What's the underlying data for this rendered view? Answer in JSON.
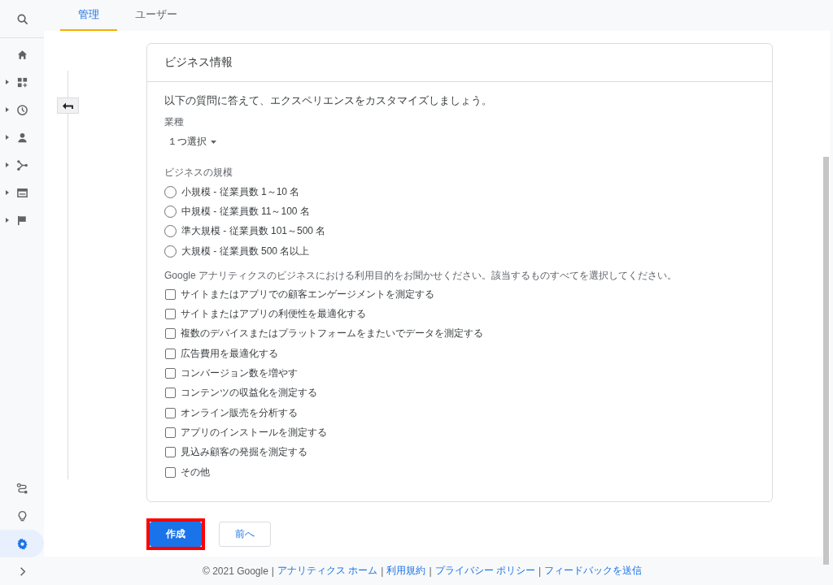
{
  "sidebar": {
    "top_items": [
      {
        "kind": "search",
        "expandable": false,
        "selected": false
      },
      {
        "kind": "home",
        "expandable": false,
        "selected": false
      },
      {
        "kind": "dashboard",
        "expandable": true,
        "selected": false
      },
      {
        "kind": "clock",
        "expandable": true,
        "selected": false
      },
      {
        "kind": "person",
        "expandable": true,
        "selected": false
      },
      {
        "kind": "branch",
        "expandable": true,
        "selected": false
      },
      {
        "kind": "screen",
        "expandable": true,
        "selected": false
      },
      {
        "kind": "flag",
        "expandable": true,
        "selected": false
      }
    ],
    "bottom_items": [
      {
        "kind": "route",
        "expandable": false,
        "selected": false
      },
      {
        "kind": "bulb",
        "expandable": false,
        "selected": false
      },
      {
        "kind": "gear",
        "expandable": false,
        "selected": true
      },
      {
        "kind": "chevron",
        "expandable": false,
        "selected": false
      }
    ]
  },
  "tabs": [
    {
      "label": "管理",
      "selected": true
    },
    {
      "label": "ユーザー",
      "selected": false
    }
  ],
  "card": {
    "title": "ビジネス情報",
    "intro": "以下の質問に答えて、エクスペリエンスをカスタマイズしましょう。",
    "industry": {
      "label": "業種",
      "value": "１つ選択"
    },
    "size": {
      "label": "ビジネスの規模",
      "options": [
        {
          "label": "小規模 - 従業員数 1～10 名",
          "selected": false
        },
        {
          "label": "中規模 - 従業員数 11～100 名",
          "selected": false
        },
        {
          "label": "準大規模 - 従業員数 101～500 名",
          "selected": false
        },
        {
          "label": "大規模 - 従業員数 500 名以上",
          "selected": false
        }
      ]
    },
    "purpose": {
      "label": "Google アナリティクスのビジネスにおける利用目的をお聞かせください。該当するものすべてを選択してください。",
      "options": [
        {
          "label": "サイトまたはアプリでの顧客エンゲージメントを測定する",
          "checked": false
        },
        {
          "label": "サイトまたはアプリの利便性を最適化する",
          "checked": false
        },
        {
          "label": "複数のデバイスまたはプラットフォームをまたいでデータを測定する",
          "checked": false
        },
        {
          "label": "広告費用を最適化する",
          "checked": false
        },
        {
          "label": "コンバージョン数を増やす",
          "checked": false
        },
        {
          "label": "コンテンツの収益化を測定する",
          "checked": false
        },
        {
          "label": "オンライン販売を分析する",
          "checked": false
        },
        {
          "label": "アプリのインストールを測定する",
          "checked": false
        },
        {
          "label": "見込み顧客の発掘を測定する",
          "checked": false
        },
        {
          "label": "その他",
          "checked": false
        }
      ]
    }
  },
  "buttons": [
    {
      "label": "作成",
      "kind": "primary",
      "highlighted": true
    },
    {
      "label": "前へ",
      "kind": "secondary",
      "highlighted": false
    }
  ],
  "footer": [
    {
      "kind": "text",
      "text": "© 2021 Google"
    },
    {
      "kind": "separator",
      "text": "|"
    },
    {
      "kind": "link",
      "text": "アナリティクス ホーム"
    },
    {
      "kind": "separator",
      "text": "|"
    },
    {
      "kind": "link",
      "text": "利用規約"
    },
    {
      "kind": "separator",
      "text": "|"
    },
    {
      "kind": "link",
      "text": "プライバシー ポリシー"
    },
    {
      "kind": "separator",
      "text": "|"
    },
    {
      "kind": "link",
      "text": "フィードバックを送信"
    }
  ]
}
